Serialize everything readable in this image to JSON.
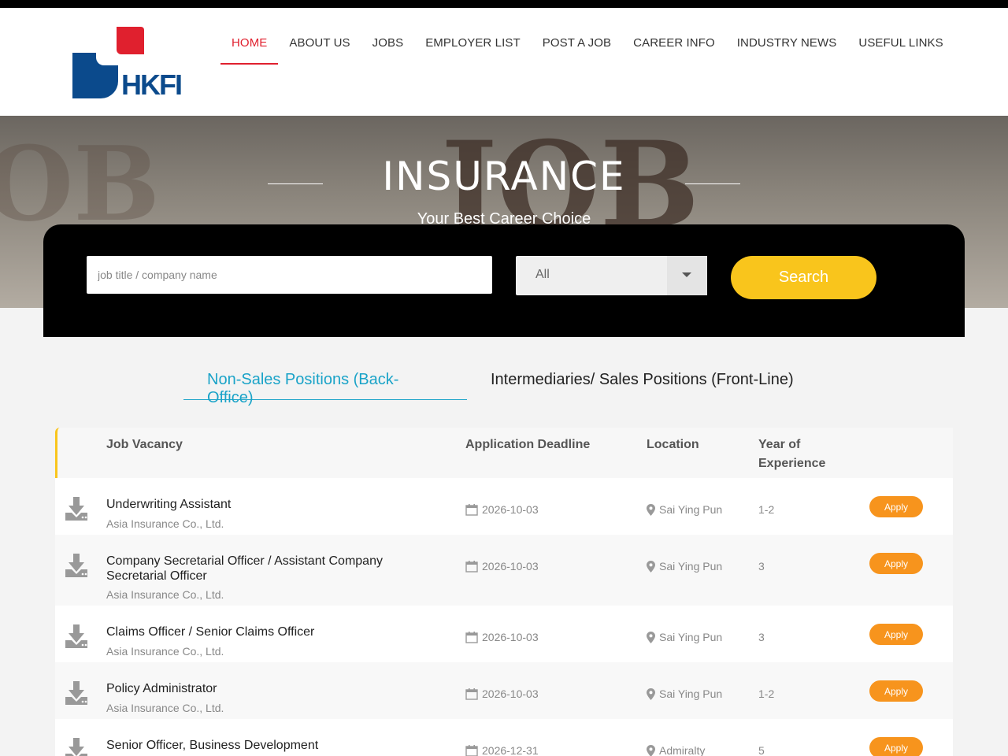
{
  "brand": {
    "name": "HKFI",
    "colors": {
      "red": "#e0202e",
      "blue": "#0b4a8c"
    }
  },
  "nav": {
    "items": [
      {
        "label": "HOME",
        "active": true
      },
      {
        "label": "ABOUT US"
      },
      {
        "label": "JOBS"
      },
      {
        "label": "EMPLOYER LIST"
      },
      {
        "label": "POST A JOB"
      },
      {
        "label": "CAREER INFO"
      },
      {
        "label": "INDUSTRY NEWS"
      },
      {
        "label": "USEFUL LINKS"
      }
    ]
  },
  "hero": {
    "title": "INSURANCE",
    "subtitle": "Your Best Career Choice"
  },
  "search": {
    "placeholder": "job title / company name",
    "category_selected": "All",
    "button_label": "Search",
    "button_color": "#f9c51c"
  },
  "tabs": [
    {
      "label": "Non-Sales Positions (Back-Office)",
      "active": true
    },
    {
      "label": "Intermediaries/ Sales Positions (Front-Line)"
    }
  ],
  "table": {
    "headers": {
      "job": "Job Vacancy",
      "deadline": "Application Deadline",
      "location": "Location",
      "experience_line1": "Year of",
      "experience_line2": "Experience"
    },
    "apply_label": "Apply",
    "rows": [
      {
        "title": "Underwriting Assistant",
        "company": "Asia Insurance Co., Ltd.",
        "deadline": "2026-10-03",
        "location": "Sai Ying Pun",
        "experience": "1-2"
      },
      {
        "title": "Company Secretarial Officer / Assistant Company Secretarial Officer",
        "company": "Asia Insurance Co., Ltd.",
        "deadline": "2026-10-03",
        "location": "Sai Ying Pun",
        "experience": "3"
      },
      {
        "title": "Claims Officer / Senior Claims Officer",
        "company": "Asia Insurance Co., Ltd.",
        "deadline": "2026-10-03",
        "location": "Sai Ying Pun",
        "experience": "3"
      },
      {
        "title": "Policy Administrator",
        "company": "Asia Insurance Co., Ltd.",
        "deadline": "2026-10-03",
        "location": "Sai Ying Pun",
        "experience": "1-2"
      },
      {
        "title": "Senior Officer, Business Development",
        "company": "",
        "deadline": "2026-12-31",
        "location": "Admiralty",
        "experience": "5"
      }
    ]
  }
}
